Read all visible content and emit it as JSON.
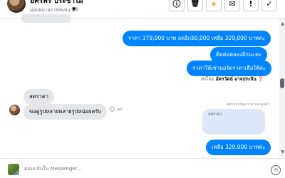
{
  "header": {
    "contact_name": "อัครพร ประชาไม้",
    "subtitle": "มอบหมายการสนทนาให้",
    "buttons": [
      {
        "name": "info-button",
        "glyph": "!"
      },
      {
        "name": "delete-button",
        "glyph": "🗑"
      },
      {
        "name": "star-button",
        "glyph": "★"
      },
      {
        "name": "mark-unread-button",
        "glyph": "✉"
      },
      {
        "name": "report-button",
        "glyph": "!"
      },
      {
        "name": "done-button",
        "glyph": "✓"
      }
    ],
    "accent": "#f7a33c"
  },
  "messages": {
    "top_partial": "",
    "out_1": "ราคา 379,000 บาท ลดอีก50,000 เหลือ 329,000 บาทค่ะ",
    "out_2": "ติดต่อตลองอีกนะคะ",
    "out_3": "ราคาให้เช่าบอร์ดราคาเลือให้ค่ะ",
    "sent_by_prefix": "ส่งโดย",
    "sent_by_name": "อัครวัตน์ อาจประจิน",
    "in_1": "สตราคา",
    "in_2": "ขอดูรูปหลายพลายรูปหน่อยครับ",
    "quote_note": "ตอบกลับข้อความ ของลูกค้า",
    "quote_text": "สตราคา",
    "out_reply": "เหลือ 329,000 บาทค่ะ",
    "bubble_out_color": "#0084ff",
    "bubble_in_color": "#e4e6eb"
  },
  "composer": {
    "placeholder": "ตอบกลับใน Messenger..."
  }
}
